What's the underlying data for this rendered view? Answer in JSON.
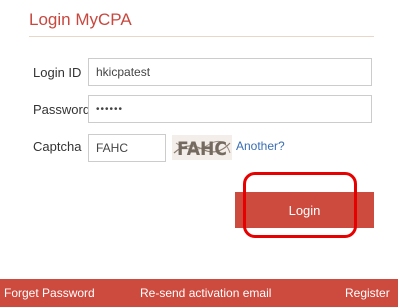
{
  "login": {
    "title": "Login MyCPA",
    "login_id_label": "Login ID",
    "login_id_value": "hkicpatest",
    "password_label": "Password",
    "password_value": "••••••",
    "captcha_label": "Captcha",
    "captcha_value": "FAHC",
    "captcha_image_text": "FAHC",
    "another_link": "Another?",
    "login_button": "Login"
  },
  "footer": {
    "forget_password": "Forget Password",
    "resend_activation": "Re-send activation email",
    "register": "Register"
  },
  "colors": {
    "accent": "#cc4a3e",
    "title": "#c8483f",
    "link": "#3a6db3",
    "annotation": "#e60000"
  }
}
